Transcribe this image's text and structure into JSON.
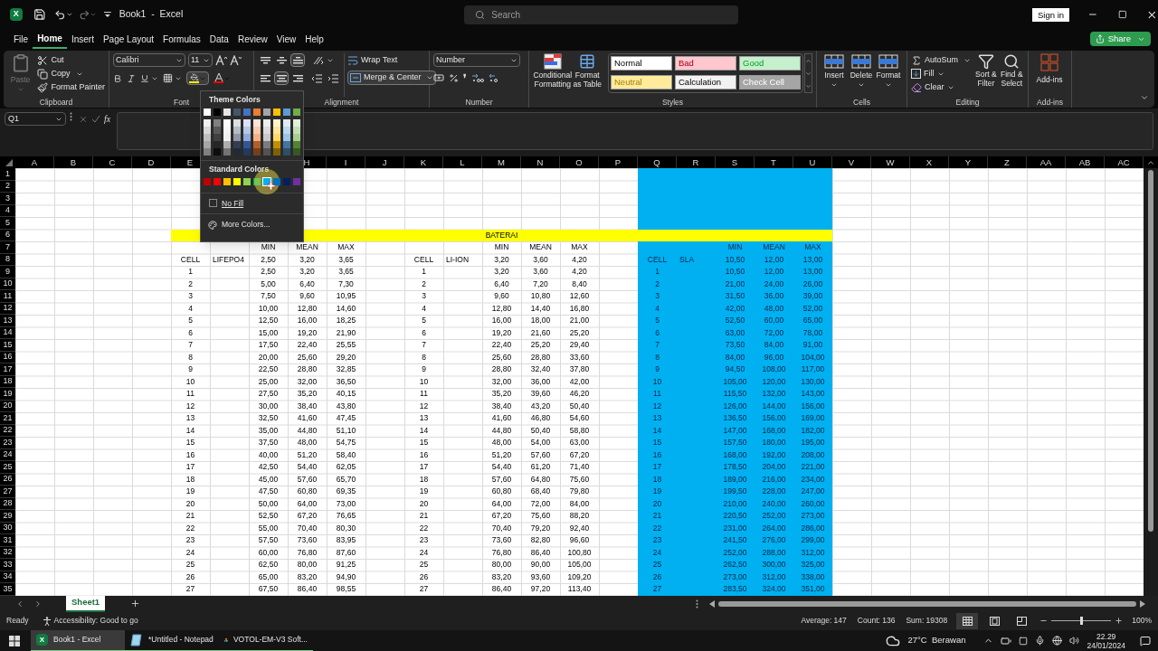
{
  "title_bar": {
    "app_icon": "X",
    "document": "Book1  -  Excel",
    "search": {
      "placeholder": "Search"
    },
    "sign_in": "Sign in"
  },
  "menu": {
    "tabs": [
      {
        "label": "File",
        "selected": false
      },
      {
        "label": "Home",
        "selected": true
      },
      {
        "label": "Insert",
        "selected": false
      },
      {
        "label": "Page Layout",
        "selected": false
      },
      {
        "label": "Formulas",
        "selected": false
      },
      {
        "label": "Data",
        "selected": false
      },
      {
        "label": "Review",
        "selected": false
      },
      {
        "label": "View",
        "selected": false
      },
      {
        "label": "Help",
        "selected": false
      }
    ],
    "share": "Share"
  },
  "ribbon": {
    "clipboard": {
      "label": "Clipboard",
      "paste": "Paste",
      "paste_disabled": true,
      "cut": "Cut",
      "copy": "Copy",
      "format_painter": "Format Painter"
    },
    "font": {
      "label": "Font",
      "name": "Calibri",
      "size": "11",
      "fill_button": {
        "color": "#ffff00"
      },
      "font_color_button": {
        "color": "#ff0000"
      }
    },
    "alignment": {
      "label": "Alignment",
      "vertical": [
        {
          "selected": false
        },
        {
          "selected": false
        },
        {
          "selected": true
        }
      ],
      "horizontal": [
        {
          "selected": false
        },
        {
          "selected": true
        },
        {
          "selected": false
        }
      ],
      "wrap_text": "Wrap Text",
      "merge": "Merge & Center"
    },
    "number": {
      "label": "Number",
      "format": "Number",
      "comma_style": "❜"
    },
    "styles": {
      "label": "Styles",
      "conditional": "Conditional Formatting",
      "format_table": "Format as Table",
      "cell_styles": [
        {
          "label": "Normal",
          "color": "#ffffff"
        },
        {
          "label": "Bad",
          "color": "#ffc7ce"
        },
        {
          "label": "Good",
          "color": "#c6efce"
        },
        {
          "label": "Neutral",
          "color": "#ffeb9c"
        },
        {
          "label": "Calculation",
          "color": "#f2f2f2"
        },
        {
          "label": "Check Cell",
          "color": "#a5a5a5"
        }
      ]
    },
    "cells": {
      "label": "Cells",
      "buttons": [
        "Insert",
        "Delete",
        "Format"
      ]
    },
    "editing": {
      "label": "Editing",
      "autosum": "AutoSum",
      "fill": "Fill",
      "clear": "Clear",
      "sort": "Sort & Filter",
      "find": "Find & Select"
    },
    "addins": {
      "label": "Add-ins",
      "button": "Add-ins"
    }
  },
  "fill_menu": {
    "theme_title": "Theme Colors",
    "theme": [
      {
        "color": "#ffffff"
      },
      {
        "color": "#000000"
      },
      {
        "color": "#e7e6e6"
      },
      {
        "color": "#44546a"
      },
      {
        "color": "#4472c4"
      },
      {
        "color": "#ed7d31"
      },
      {
        "color": "#a5a5a5"
      },
      {
        "color": "#ffc000"
      },
      {
        "color": "#5b9bd5"
      },
      {
        "color": "#70ad47"
      }
    ],
    "standard_title": "Standard Colors",
    "standard": [
      {
        "color": "#c00000",
        "selected": false
      },
      {
        "color": "#ff0000",
        "selected": false
      },
      {
        "color": "#ffc000",
        "selected": false
      },
      {
        "color": "#ffff00",
        "selected": false
      },
      {
        "color": "#92d050",
        "selected": false
      },
      {
        "color": "#00b050",
        "selected": false
      },
      {
        "color": "#00b0f0",
        "selected": true
      },
      {
        "color": "#0070c0",
        "selected": false
      },
      {
        "color": "#002060",
        "selected": false
      },
      {
        "color": "#7030a0",
        "selected": false
      }
    ],
    "no_fill": "No Fill",
    "more": "More Colors..."
  },
  "formula_bar": {
    "name_box": "Q1",
    "fx": "fx"
  },
  "sheet": {
    "columns": [
      {
        "label": "A"
      },
      {
        "label": "B"
      },
      {
        "label": "C"
      },
      {
        "label": "D"
      },
      {
        "label": "E"
      },
      {},
      {},
      {
        "label": "H"
      },
      {
        "label": "I"
      },
      {
        "label": "J"
      },
      {
        "label": "K"
      },
      {
        "label": "L"
      },
      {
        "label": "M"
      },
      {
        "label": "N"
      },
      {
        "label": "O"
      },
      {
        "label": "P"
      },
      {
        "label": "Q"
      },
      {
        "label": "R"
      },
      {
        "label": "S"
      },
      {
        "label": "T"
      },
      {
        "label": "U"
      },
      {
        "label": "V"
      },
      {
        "label": "W"
      },
      {
        "label": "X"
      },
      {
        "label": "Y"
      },
      {
        "label": "Z"
      },
      {
        "label": "AA"
      },
      {
        "label": "AB"
      },
      {
        "label": "AC"
      }
    ],
    "fills": [
      {
        "color": "#00b0f0"
      },
      {
        "color": "#ffff00"
      },
      {
        "color": "#00b0f0"
      }
    ],
    "rows": [
      {
        "number": "1"
      },
      {
        "number": "2"
      },
      {
        "number": "3"
      },
      {
        "number": "4"
      },
      {
        "number": "5"
      },
      {
        "number": "6",
        "banner": "BATERAI"
      },
      {
        "number": "7",
        "cells": {
          "G": "MIN",
          "H": "MEAN",
          "I": "MAX",
          "M": "MIN",
          "N": "MEAN",
          "O": "MAX",
          "S": "MIN",
          "T": "MEAN",
          "U": "MAX"
        }
      },
      {
        "number": "8",
        "cells": {
          "E": "CELL",
          "F": "LIFEPO4",
          "G": "2,50",
          "H": "3,20",
          "I": "3,65",
          "K": "CELL",
          "L": "LI-ION",
          "M": "3,20",
          "N": "3,60",
          "O": "4,20",
          "Q": "CELL",
          "R": "SLA",
          "S": "10,50",
          "T": "12,00",
          "U": "13,00"
        }
      },
      {
        "number": "9",
        "cells": {
          "E": "1",
          "G": "2,50",
          "H": "3,20",
          "I": "3,65",
          "K": "1",
          "M": "3,20",
          "N": "3,60",
          "O": "4,20",
          "Q": "1",
          "S": "10,50",
          "T": "12,00",
          "U": "13,00"
        }
      },
      {
        "number": "10",
        "cells": {
          "E": "2",
          "G": "5,00",
          "H": "6,40",
          "I": "7,30",
          "K": "2",
          "M": "6,40",
          "N": "7,20",
          "O": "8,40",
          "Q": "2",
          "S": "21,00",
          "T": "24,00",
          "U": "26,00"
        }
      },
      {
        "number": "11",
        "cells": {
          "E": "3",
          "G": "7,50",
          "H": "9,60",
          "I": "10,95",
          "K": "3",
          "M": "9,60",
          "N": "10,80",
          "O": "12,60",
          "Q": "3",
          "S": "31,50",
          "T": "36,00",
          "U": "39,00"
        }
      },
      {
        "number": "12",
        "cells": {
          "E": "4",
          "G": "10,00",
          "H": "12,80",
          "I": "14,60",
          "K": "4",
          "M": "12,80",
          "N": "14,40",
          "O": "16,80",
          "Q": "4",
          "S": "42,00",
          "T": "48,00",
          "U": "52,00"
        }
      },
      {
        "number": "13",
        "cells": {
          "E": "5",
          "G": "12,50",
          "H": "16,00",
          "I": "18,25",
          "K": "5",
          "M": "16,00",
          "N": "18,00",
          "O": "21,00",
          "Q": "5",
          "S": "52,50",
          "T": "60,00",
          "U": "65,00"
        }
      },
      {
        "number": "14",
        "cells": {
          "E": "6",
          "G": "15,00",
          "H": "19,20",
          "I": "21,90",
          "K": "6",
          "M": "19,20",
          "N": "21,60",
          "O": "25,20",
          "Q": "6",
          "S": "63,00",
          "T": "72,00",
          "U": "78,00"
        }
      },
      {
        "number": "15",
        "cells": {
          "E": "7",
          "G": "17,50",
          "H": "22,40",
          "I": "25,55",
          "K": "7",
          "M": "22,40",
          "N": "25,20",
          "O": "29,40",
          "Q": "7",
          "S": "73,50",
          "T": "84,00",
          "U": "91,00"
        }
      },
      {
        "number": "16",
        "cells": {
          "E": "8",
          "G": "20,00",
          "H": "25,60",
          "I": "29,20",
          "K": "8",
          "M": "25,60",
          "N": "28,80",
          "O": "33,60",
          "Q": "8",
          "S": "84,00",
          "T": "96,00",
          "U": "104,00"
        }
      },
      {
        "number": "17",
        "cells": {
          "E": "9",
          "G": "22,50",
          "H": "28,80",
          "I": "32,85",
          "K": "9",
          "M": "28,80",
          "N": "32,40",
          "O": "37,80",
          "Q": "9",
          "S": "94,50",
          "T": "108,00",
          "U": "117,00"
        }
      },
      {
        "number": "18",
        "cells": {
          "E": "10",
          "G": "25,00",
          "H": "32,00",
          "I": "36,50",
          "K": "10",
          "M": "32,00",
          "N": "36,00",
          "O": "42,00",
          "Q": "10",
          "S": "105,00",
          "T": "120,00",
          "U": "130,00"
        }
      },
      {
        "number": "19",
        "cells": {
          "E": "11",
          "G": "27,50",
          "H": "35,20",
          "I": "40,15",
          "K": "11",
          "M": "35,20",
          "N": "39,60",
          "O": "46,20",
          "Q": "11",
          "S": "115,50",
          "T": "132,00",
          "U": "143,00"
        }
      },
      {
        "number": "20",
        "cells": {
          "E": "12",
          "G": "30,00",
          "H": "38,40",
          "I": "43,80",
          "K": "12",
          "M": "38,40",
          "N": "43,20",
          "O": "50,40",
          "Q": "12",
          "S": "126,00",
          "T": "144,00",
          "U": "156,00"
        }
      },
      {
        "number": "21",
        "cells": {
          "E": "13",
          "G": "32,50",
          "H": "41,60",
          "I": "47,45",
          "K": "13",
          "M": "41,60",
          "N": "46,80",
          "O": "54,60",
          "Q": "13",
          "S": "136,50",
          "T": "156,00",
          "U": "169,00"
        }
      },
      {
        "number": "22",
        "cells": {
          "E": "14",
          "G": "35,00",
          "H": "44,80",
          "I": "51,10",
          "K": "14",
          "M": "44,80",
          "N": "50,40",
          "O": "58,80",
          "Q": "14",
          "S": "147,00",
          "T": "168,00",
          "U": "182,00"
        }
      },
      {
        "number": "23",
        "cells": {
          "E": "15",
          "G": "37,50",
          "H": "48,00",
          "I": "54,75",
          "K": "15",
          "M": "48,00",
          "N": "54,00",
          "O": "63,00",
          "Q": "15",
          "S": "157,50",
          "T": "180,00",
          "U": "195,00"
        }
      },
      {
        "number": "24",
        "cells": {
          "E": "16",
          "G": "40,00",
          "H": "51,20",
          "I": "58,40",
          "K": "16",
          "M": "51,20",
          "N": "57,60",
          "O": "67,20",
          "Q": "16",
          "S": "168,00",
          "T": "192,00",
          "U": "208,00"
        }
      },
      {
        "number": "25",
        "cells": {
          "E": "17",
          "G": "42,50",
          "H": "54,40",
          "I": "62,05",
          "K": "17",
          "M": "54,40",
          "N": "61,20",
          "O": "71,40",
          "Q": "17",
          "S": "178,50",
          "T": "204,00",
          "U": "221,00"
        }
      },
      {
        "number": "26",
        "cells": {
          "E": "18",
          "G": "45,00",
          "H": "57,60",
          "I": "65,70",
          "K": "18",
          "M": "57,60",
          "N": "64,80",
          "O": "75,60",
          "Q": "18",
          "S": "189,00",
          "T": "216,00",
          "U": "234,00"
        }
      },
      {
        "number": "27",
        "cells": {
          "E": "19",
          "G": "47,50",
          "H": "60,80",
          "I": "69,35",
          "K": "19",
          "M": "60,80",
          "N": "68,40",
          "O": "79,80",
          "Q": "19",
          "S": "199,50",
          "T": "228,00",
          "U": "247,00"
        }
      },
      {
        "number": "28",
        "cells": {
          "E": "20",
          "G": "50,00",
          "H": "64,00",
          "I": "73,00",
          "K": "20",
          "M": "64,00",
          "N": "72,00",
          "O": "84,00",
          "Q": "20",
          "S": "210,00",
          "T": "240,00",
          "U": "260,00"
        }
      },
      {
        "number": "29",
        "cells": {
          "E": "21",
          "G": "52,50",
          "H": "67,20",
          "I": "76,65",
          "K": "21",
          "M": "67,20",
          "N": "75,60",
          "O": "88,20",
          "Q": "21",
          "S": "220,50",
          "T": "252,00",
          "U": "273,00"
        }
      },
      {
        "number": "30",
        "cells": {
          "E": "22",
          "G": "55,00",
          "H": "70,40",
          "I": "80,30",
          "K": "22",
          "M": "70,40",
          "N": "79,20",
          "O": "92,40",
          "Q": "22",
          "S": "231,00",
          "T": "264,00",
          "U": "286,00"
        }
      },
      {
        "number": "31",
        "cells": {
          "E": "23",
          "G": "57,50",
          "H": "73,60",
          "I": "83,95",
          "K": "23",
          "M": "73,60",
          "N": "82,80",
          "O": "96,60",
          "Q": "23",
          "S": "241,50",
          "T": "276,00",
          "U": "299,00"
        }
      },
      {
        "number": "32",
        "cells": {
          "E": "24",
          "G": "60,00",
          "H": "76,80",
          "I": "87,60",
          "K": "24",
          "M": "76,80",
          "N": "86,40",
          "O": "100,80",
          "Q": "24",
          "S": "252,00",
          "T": "288,00",
          "U": "312,00"
        }
      },
      {
        "number": "33",
        "cells": {
          "E": "25",
          "G": "62,50",
          "H": "80,00",
          "I": "91,25",
          "K": "25",
          "M": "80,00",
          "N": "90,00",
          "O": "105,00",
          "Q": "25",
          "S": "262,50",
          "T": "300,00",
          "U": "325,00"
        }
      },
      {
        "number": "34",
        "cells": {
          "E": "26",
          "G": "65,00",
          "H": "83,20",
          "I": "94,90",
          "K": "26",
          "M": "83,20",
          "N": "93,60",
          "O": "109,20",
          "Q": "26",
          "S": "273,00",
          "T": "312,00",
          "U": "338,00"
        }
      },
      {
        "number": "35",
        "cells": {
          "E": "27",
          "G": "67,50",
          "H": "86,40",
          "I": "98,55",
          "K": "27",
          "M": "86,40",
          "N": "97,20",
          "O": "113,40",
          "Q": "27",
          "S": "283,50",
          "T": "324,00",
          "U": "351,00"
        }
      }
    ]
  },
  "sheet_tabs": [
    {
      "label": "Sheet1",
      "selected": true
    }
  ],
  "status": {
    "ready": "Ready",
    "accessibility": "Accessibility: Good to go",
    "stats": [
      "Average: 147",
      "Count: 136",
      "Sum: 19308"
    ],
    "views": [
      {
        "selected": true
      },
      {
        "selected": false
      },
      {
        "selected": false
      }
    ],
    "zoom": {
      "level": 0.5,
      "reading": "100%"
    }
  },
  "taskbar": {
    "apps": [
      {
        "label": "Book1 - Excel",
        "kind": "excel",
        "icon_letter": "X",
        "selected": true
      },
      {
        "label": "*Untitled - Notepad",
        "kind": "notepad",
        "selected": false
      },
      {
        "label": "VOTOL-EM-V3 Soft...",
        "kind": "tool",
        "selected": false
      }
    ],
    "weather": "27°C  Berawan",
    "time": "22.29",
    "date": "24/01/2024"
  }
}
